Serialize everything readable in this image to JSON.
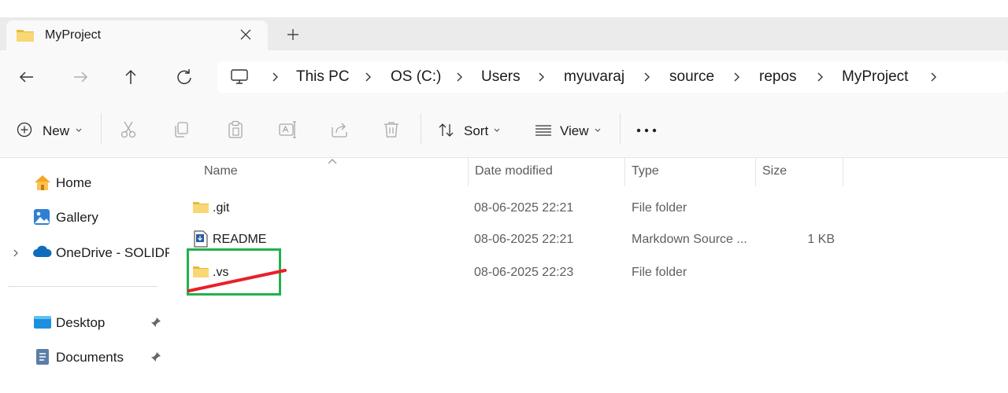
{
  "tab": {
    "title": "MyProject",
    "close_icon": "close-icon",
    "new_tab_icon": "plus-icon"
  },
  "nav": {
    "back_icon": "arrow-left-icon",
    "forward_icon": "arrow-right-icon",
    "up_icon": "arrow-up-icon",
    "refresh_icon": "refresh-icon"
  },
  "breadcrumb": {
    "root_icon": "monitor-icon",
    "items": [
      "This PC",
      "OS (C:)",
      "Users",
      "myuvaraj",
      "source",
      "repos",
      "MyProject"
    ]
  },
  "toolbar": {
    "new_label": "New",
    "sort_label": "Sort",
    "view_label": "View",
    "more_icon": "more-icon",
    "icons": [
      "cut-icon",
      "copy-icon",
      "paste-icon",
      "rename-icon",
      "share-icon",
      "delete-icon"
    ]
  },
  "sidebar": {
    "home": "Home",
    "gallery": "Gallery",
    "onedrive": "OneDrive - SOLIDPI",
    "desktop": "Desktop",
    "documents": "Documents"
  },
  "columns": {
    "name": "Name",
    "date": "Date modified",
    "type": "Type",
    "size": "Size"
  },
  "files": [
    {
      "name": ".git",
      "date": "08-06-2025 22:21",
      "type": "File folder",
      "size": "",
      "icon": "folder-icon"
    },
    {
      "name": "README",
      "date": "08-06-2025 22:21",
      "type": "Markdown Source ...",
      "size": "1 KB",
      "icon": "markdown-file-icon"
    },
    {
      "name": ".vs",
      "date": "08-06-2025 22:23",
      "type": "File folder",
      "size": "",
      "icon": "folder-icon"
    }
  ],
  "colors": {
    "folder": "#f8d775",
    "annotation_box": "#22b14c",
    "annotation_strike": "#e8202a",
    "onedrive": "#0f6cbd"
  }
}
